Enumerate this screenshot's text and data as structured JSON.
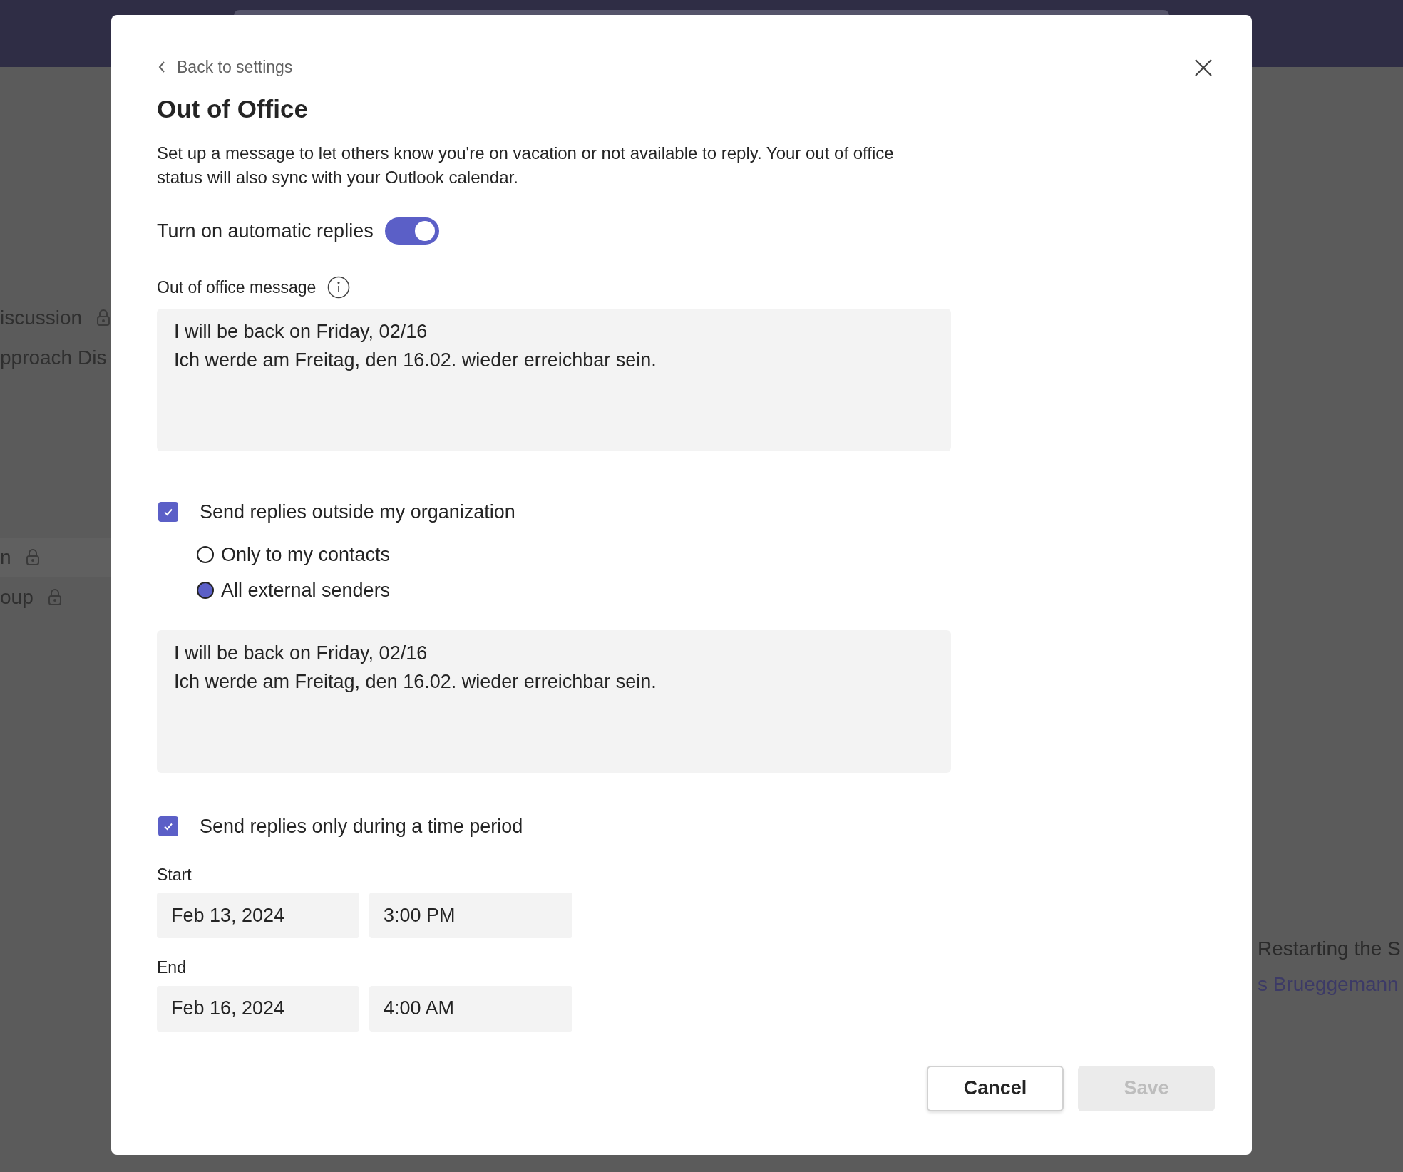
{
  "background": {
    "left_items": [
      {
        "text": "iscussion",
        "locked": true
      },
      {
        "text": "pproach Dis",
        "locked": false
      },
      {
        "text": "n",
        "locked": true
      },
      {
        "text": "oup",
        "locked": true
      }
    ],
    "right_items": [
      {
        "text": "Restarting the S",
        "kind": "title"
      },
      {
        "text": "s Brueggemann",
        "kind": "name"
      }
    ]
  },
  "dialog": {
    "back_link": "Back to settings",
    "title": "Out of Office",
    "description": "Set up a message to let others know you're on vacation or not available to reply. Your out of office status will also sync with your Outlook calendar.",
    "toggle": {
      "label": "Turn on automatic replies",
      "on": true
    },
    "message_label": "Out of office message",
    "message": {
      "value": "I will be back on Friday, 02/16\nIch werde am Freitag, den 16.02. wieder erreichbar sein."
    },
    "outside": {
      "label": "Send replies outside my organization",
      "checked": true,
      "options": [
        {
          "label": "Only to my contacts",
          "selected": false
        },
        {
          "label": "All external senders",
          "selected": true
        }
      ],
      "message": {
        "value": "I will be back on Friday, 02/16\nIch werde am Freitag, den 16.02. wieder erreichbar sein."
      }
    },
    "time_period": {
      "label": "Send replies only during a time period",
      "checked": true,
      "ranges": [
        {
          "label": "Start",
          "date": "Feb 13, 2024",
          "time": "3:00 PM"
        },
        {
          "label": "End",
          "date": "Feb 16, 2024",
          "time": "4:00 AM"
        }
      ]
    },
    "buttons": [
      {
        "label": "Cancel",
        "disabled": false
      },
      {
        "label": "Save",
        "disabled": true
      }
    ]
  }
}
